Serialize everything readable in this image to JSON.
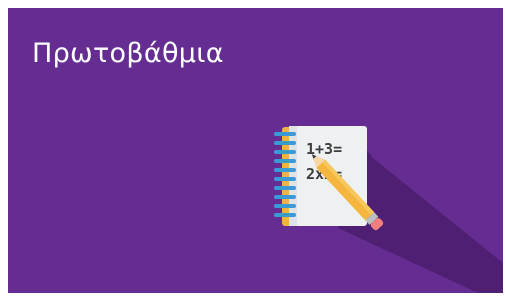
{
  "tile": {
    "title": "Πρωτοβάθμια",
    "icon": "math-notebook-pencil-icon",
    "notebook_lines": [
      "1+3=",
      "2x2="
    ]
  },
  "colors": {
    "background": "#652d91",
    "shadow": "#4e1f73",
    "title_text": "#ffffff",
    "paper": "#eef1f2",
    "cover": "#f0b43c",
    "spiral": "#3a9ad9",
    "ink": "#3d3d3d",
    "pencil": "#f4b63f"
  }
}
